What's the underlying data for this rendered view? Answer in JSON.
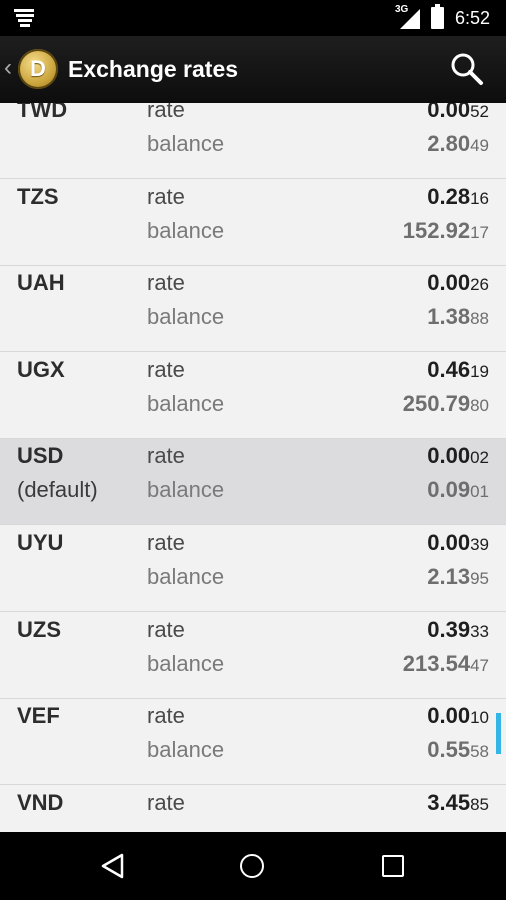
{
  "status_bar": {
    "network": "3G",
    "time": "6:52"
  },
  "action_bar": {
    "title": "Exchange rates",
    "logo_letter": "D"
  },
  "labels": {
    "rate": "rate",
    "balance": "balance"
  },
  "rows": [
    {
      "code": "TWD",
      "note": "",
      "rate_main": "0.00",
      "rate_tail": "52",
      "balance_main": "2.80",
      "balance_tail": "49",
      "is_default": false
    },
    {
      "code": "TZS",
      "note": "",
      "rate_main": "0.28",
      "rate_tail": "16",
      "balance_main": "152.92",
      "balance_tail": "17",
      "is_default": false
    },
    {
      "code": "UAH",
      "note": "",
      "rate_main": "0.00",
      "rate_tail": "26",
      "balance_main": "1.38",
      "balance_tail": "88",
      "is_default": false
    },
    {
      "code": "UGX",
      "note": "",
      "rate_main": "0.46",
      "rate_tail": "19",
      "balance_main": "250.79",
      "balance_tail": "80",
      "is_default": false
    },
    {
      "code": "USD",
      "note": "(default)",
      "rate_main": "0.00",
      "rate_tail": "02",
      "balance_main": "0.09",
      "balance_tail": "01",
      "is_default": true
    },
    {
      "code": "UYU",
      "note": "",
      "rate_main": "0.00",
      "rate_tail": "39",
      "balance_main": "2.13",
      "balance_tail": "95",
      "is_default": false
    },
    {
      "code": "UZS",
      "note": "",
      "rate_main": "0.39",
      "rate_tail": "33",
      "balance_main": "213.54",
      "balance_tail": "47",
      "is_default": false
    },
    {
      "code": "VEF",
      "note": "",
      "rate_main": "0.00",
      "rate_tail": "10",
      "balance_main": "0.55",
      "balance_tail": "58",
      "is_default": false
    },
    {
      "code": "VND",
      "note": "",
      "rate_main": "3.45",
      "rate_tail": "85",
      "balance_main": "",
      "balance_tail": "",
      "is_default": false
    }
  ],
  "icons": {
    "notification": "notification-lines-icon",
    "signal": "cell-signal-icon",
    "battery": "battery-icon",
    "up": "up-caret-icon",
    "search": "search-icon",
    "back": "nav-back-icon",
    "home": "nav-home-icon",
    "recent": "nav-recent-apps-icon"
  },
  "colors": {
    "accent": "#33b5e5",
    "default_row": "#dcdcdf"
  }
}
